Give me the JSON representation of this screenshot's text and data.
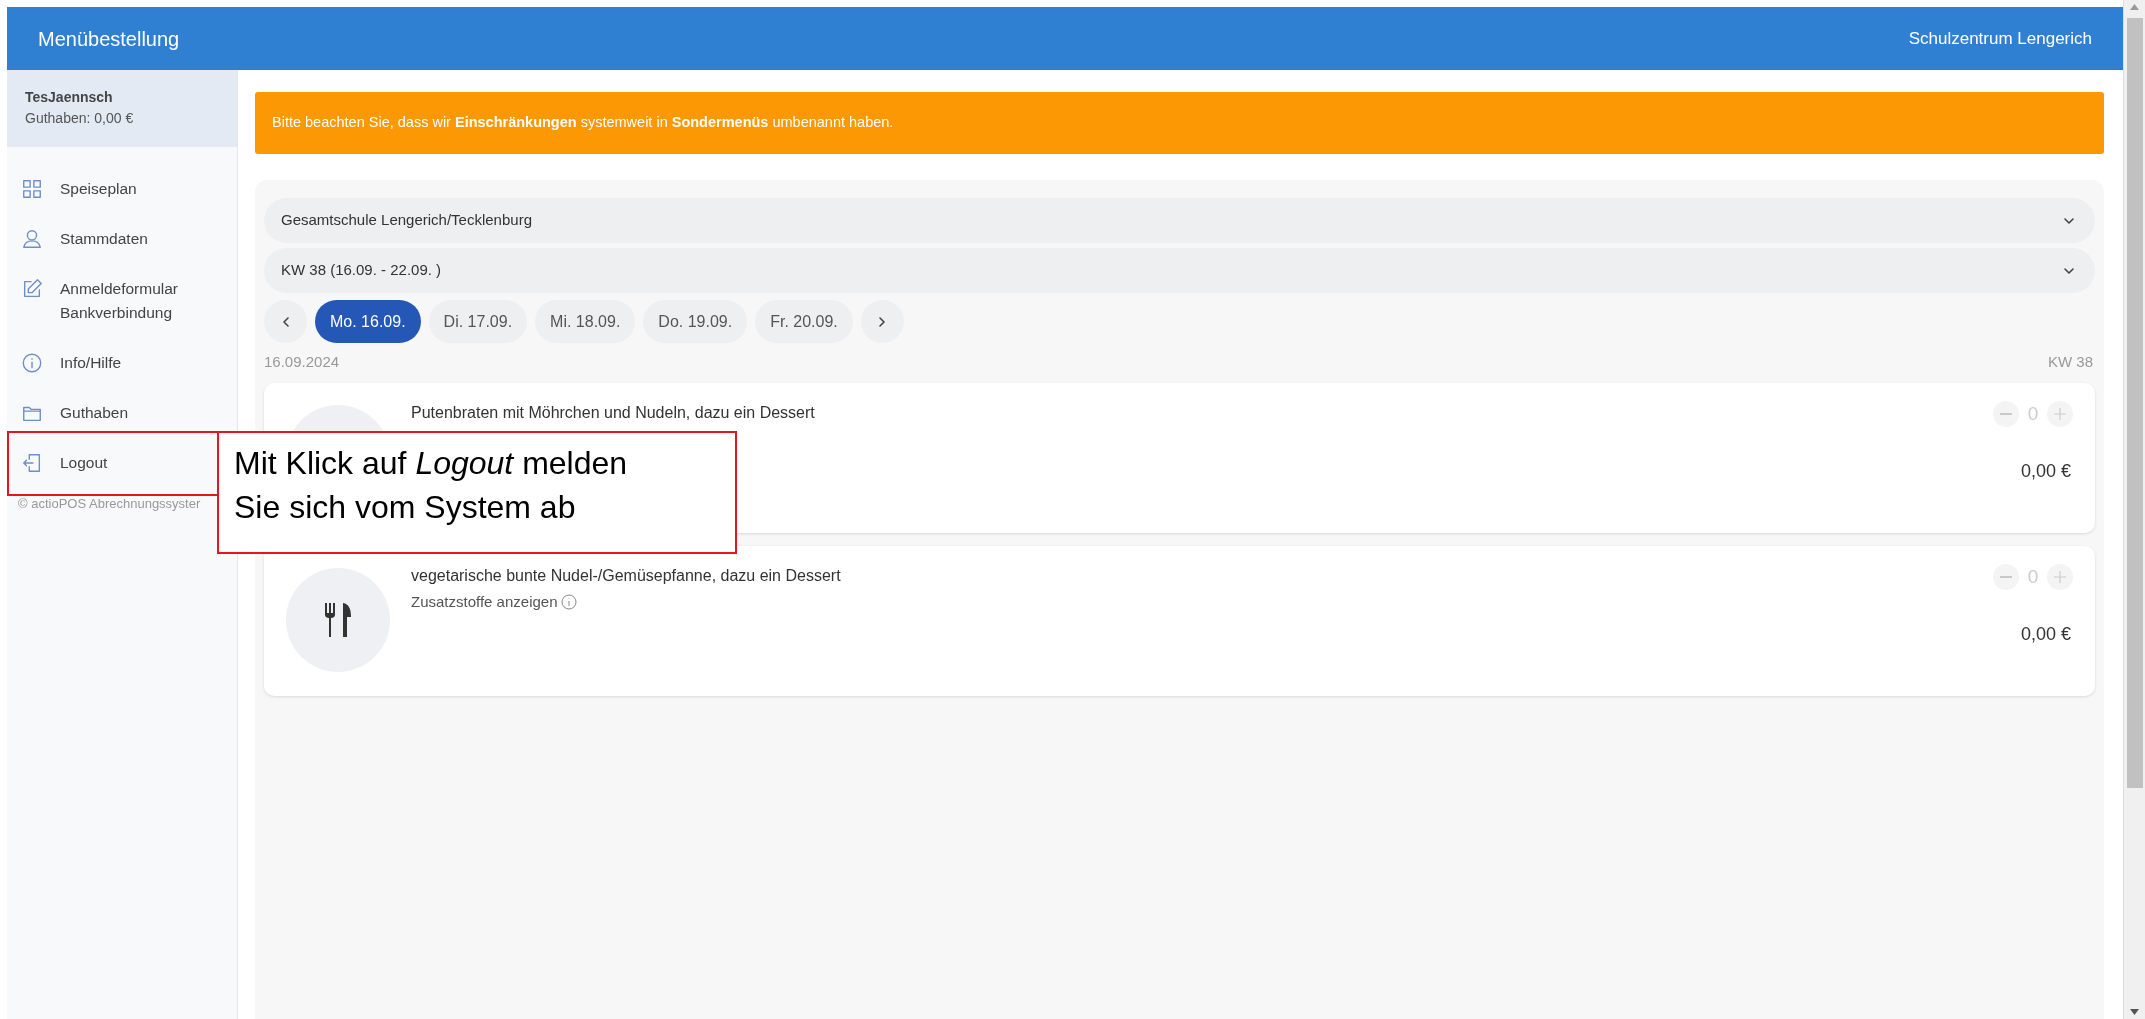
{
  "header": {
    "title": "Menübestellung",
    "school": "Schulzentrum Lengerich"
  },
  "sidebar": {
    "user": "TesJaennsch",
    "balance": "Guthaben: 0,00 €",
    "items": [
      {
        "label": "Speiseplan"
      },
      {
        "label": "Stammdaten"
      },
      {
        "label": "Anmeldeformular Bankverbindung"
      },
      {
        "label": "Info/Hilfe"
      },
      {
        "label": "Guthaben"
      },
      {
        "label": "Logout"
      }
    ],
    "footer": "© actioPOS Abrechnungssyster"
  },
  "notice": "Bitte beachten Sie, dass wir **Einschränkungen** systemweit in **Sondermenüs** umbenannt haben.",
  "location_select": "Gesamtschule Lengerich/Tecklenburg",
  "week_select": "KW 38 (16.09. - 22.09. )",
  "days": [
    {
      "label": "Mo. 16.09.",
      "selected": true
    },
    {
      "label": "Di. 17.09.",
      "selected": false
    },
    {
      "label": "Mi. 18.09.",
      "selected": false
    },
    {
      "label": "Do. 19.09.",
      "selected": false
    },
    {
      "label": "Fr. 20.09.",
      "selected": false
    }
  ],
  "date": "16.09.2024",
  "week": "KW 38",
  "meals": [
    {
      "name": "Putenbraten mit Möhrchen und Nudeln, dazu ein Dessert",
      "quantity": "0",
      "price": "0,00 €",
      "disabled": true
    },
    {
      "name": "vegetarische bunte Nudel-/Gemüsepfanne, dazu ein Dessert",
      "additives": "Zusatzstoffe anzeigen",
      "quantity": "0",
      "price": "0,00 €",
      "disabled": true
    }
  ],
  "callout": "Mit Klick auf *Logout* melden Sie sich vom System ab"
}
